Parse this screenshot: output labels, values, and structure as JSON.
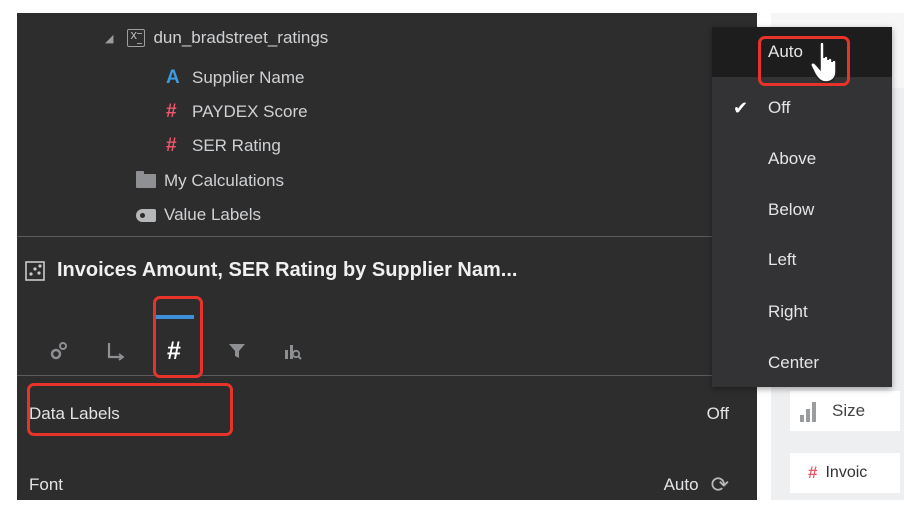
{
  "tree": {
    "dataset": "dun_bradstreet_ratings",
    "items": [
      {
        "label": "Supplier Name",
        "icon": "text-attribute-icon"
      },
      {
        "label": "PAYDEX Score",
        "icon": "measure-hash-icon"
      },
      {
        "label": "SER Rating",
        "icon": "measure-hash-icon"
      },
      {
        "label": "My Calculations",
        "icon": "folder-icon"
      },
      {
        "label": "Value Labels",
        "icon": "tag-icon"
      }
    ]
  },
  "visualization": {
    "title": "Invoices Amount, SER Rating by Supplier Nam...",
    "tabs": [
      {
        "name": "general-tab",
        "icon": "gears-icon"
      },
      {
        "name": "axis-tab",
        "icon": "axis-icon"
      },
      {
        "name": "values-tab",
        "icon": "hash-icon",
        "active": true
      },
      {
        "name": "filters-tab",
        "icon": "filter-icon"
      },
      {
        "name": "analytics-tab",
        "icon": "analytics-icon"
      }
    ],
    "hash_glyph": "#"
  },
  "properties": [
    {
      "label": "Data Labels",
      "value": "Off"
    },
    {
      "label": "Font",
      "value": "Auto"
    }
  ],
  "dropdown": {
    "items": [
      "Auto",
      "Off",
      "Above",
      "Below",
      "Left",
      "Right",
      "Center"
    ],
    "checked": "Off",
    "hovered": "Auto"
  },
  "right_panel": {
    "size_label": "Size",
    "invoice_label": "Invoic"
  },
  "colors": {
    "highlight": "#e8332b",
    "accent": "#3d8fd9",
    "measure": "#f0566b",
    "attribute": "#3e9bdc"
  }
}
